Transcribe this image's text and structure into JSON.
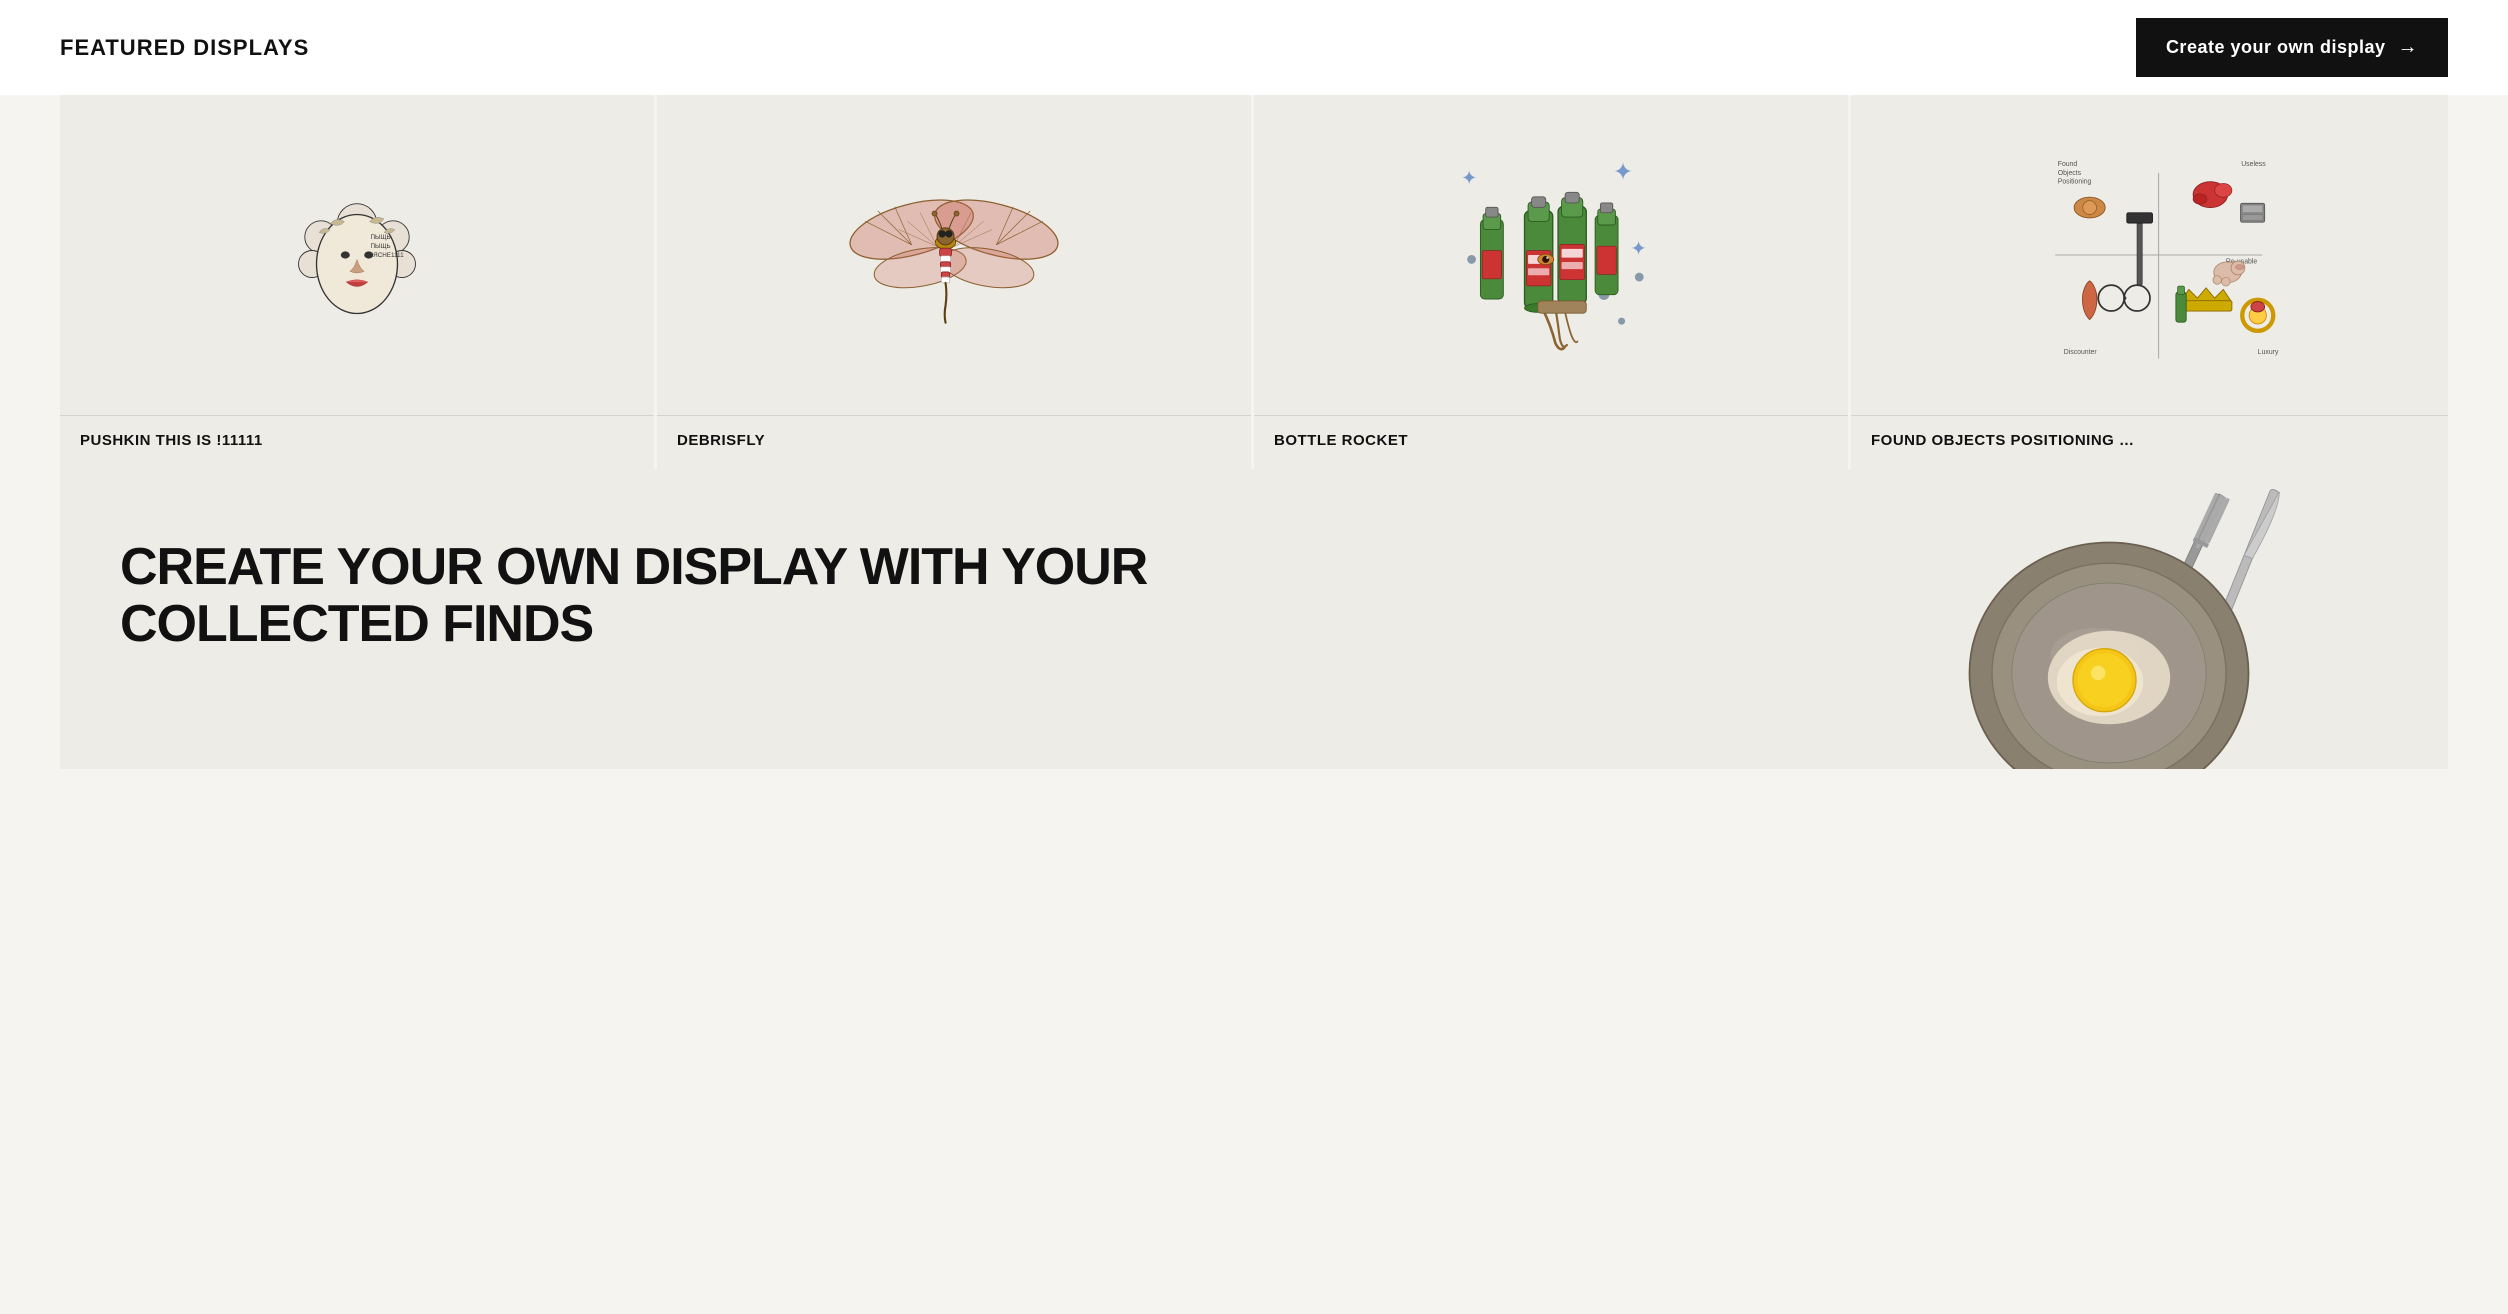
{
  "header": {
    "title": "FEATURED DISPLAYS",
    "create_button": "Create your own display",
    "arrow": "→"
  },
  "cards": [
    {
      "id": "pushkin",
      "label": "PUSHKIN THIS IS !11111",
      "type": "pushkin"
    },
    {
      "id": "debrisfly",
      "label": "DEBRISFLY",
      "type": "dragonfly"
    },
    {
      "id": "bottle-rocket",
      "label": "BOTTLE ROCKET",
      "type": "bottles"
    },
    {
      "id": "found-objects",
      "label": "FOUND OBJECTS POSITIONING …",
      "type": "grid"
    }
  ],
  "cta": {
    "text": "CREATE YOUR OWN DISPLAY WITH YOUR COLLECTED FINDS"
  },
  "colors": {
    "background": "#f5f4f0",
    "card_bg": "#eeece6",
    "text_dark": "#111111",
    "white": "#ffffff",
    "btn_bg": "#111111"
  }
}
